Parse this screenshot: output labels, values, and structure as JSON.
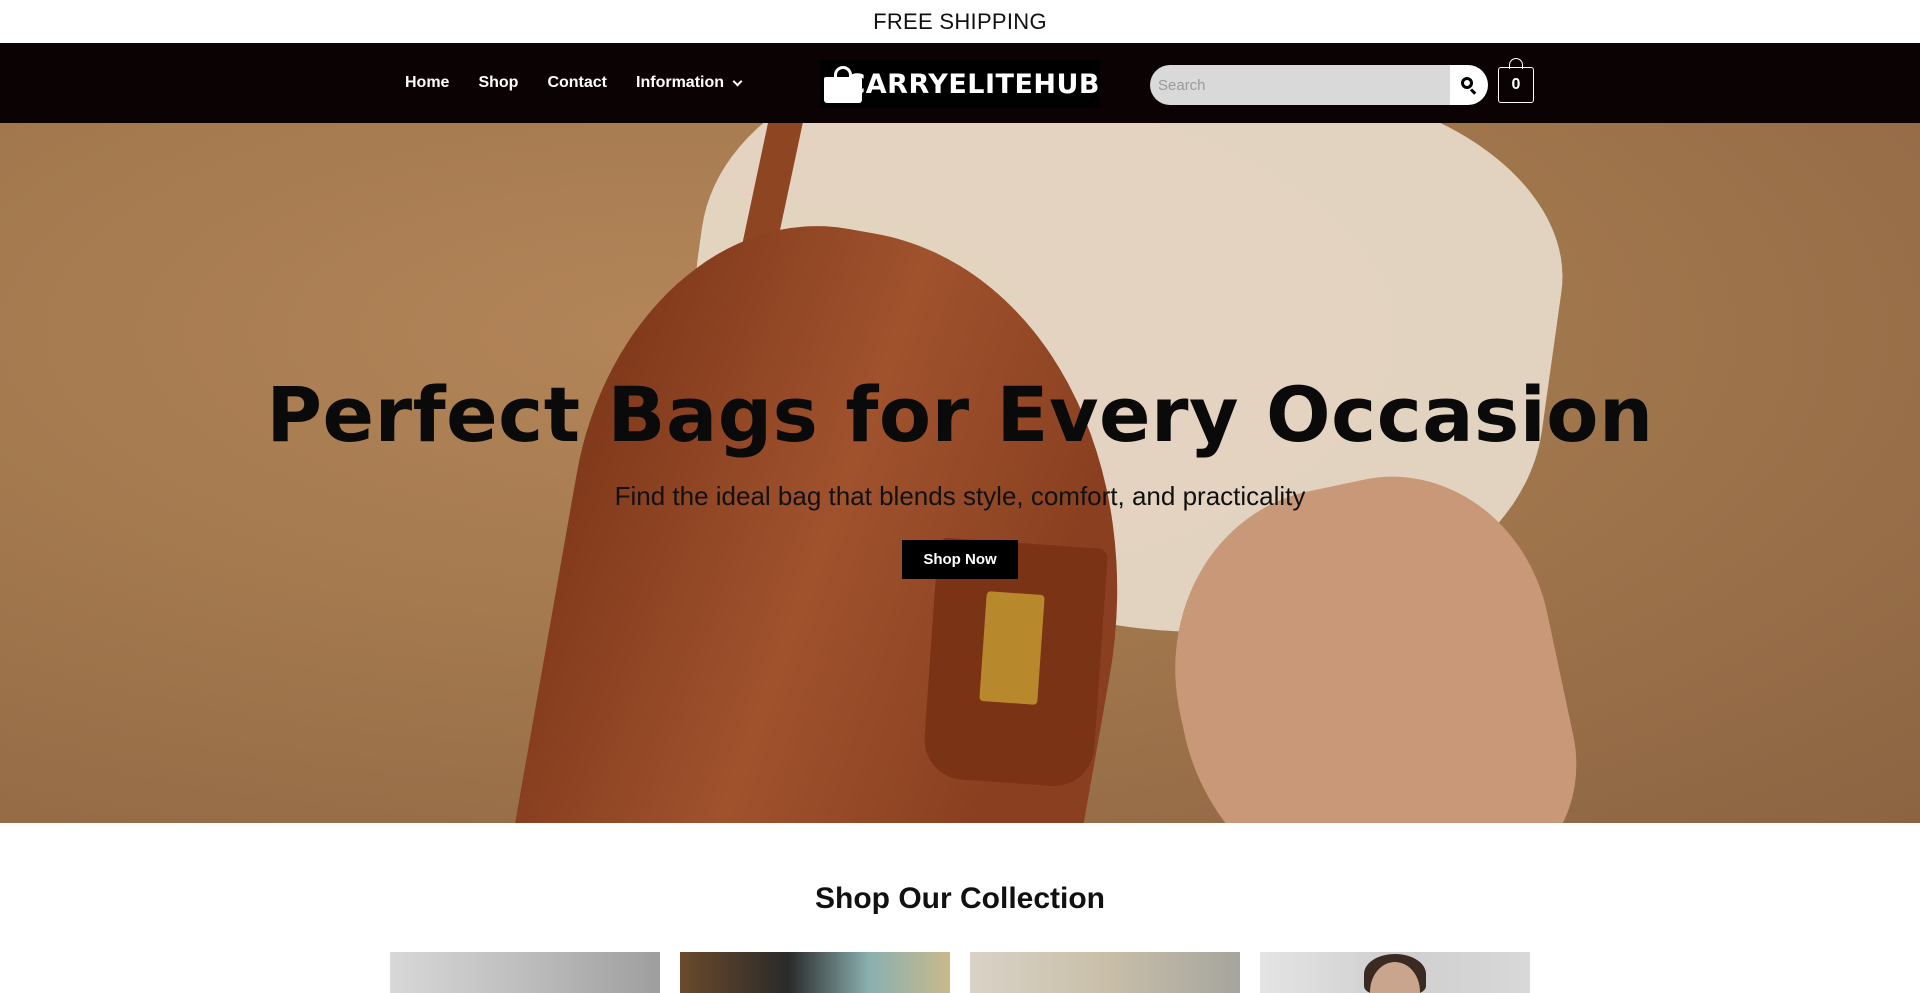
{
  "announcement": {
    "text": "FREE SHIPPING"
  },
  "nav": {
    "items": [
      {
        "label": "Home"
      },
      {
        "label": "Shop"
      },
      {
        "label": "Contact"
      },
      {
        "label": "Information",
        "has_dropdown": true
      }
    ]
  },
  "logo": {
    "text": "CARRYELITEHUB",
    "icon": "shopping-bag-icon"
  },
  "search": {
    "placeholder": "Search",
    "value": "",
    "icon": "search-icon"
  },
  "cart": {
    "count": "0",
    "icon": "cart-bag-icon"
  },
  "hero": {
    "title": "Perfect Bags for Every Occasion",
    "subtitle": "Find the ideal bag that blends style, comfort, and practicality",
    "cta_label": "Shop Now"
  },
  "collection": {
    "title": "Shop Our Collection",
    "cards": [
      {},
      {},
      {},
      {}
    ]
  },
  "colors": {
    "nav_background": "#0b0303",
    "search_background": "#d9d9d9",
    "cta_background": "#000000"
  }
}
